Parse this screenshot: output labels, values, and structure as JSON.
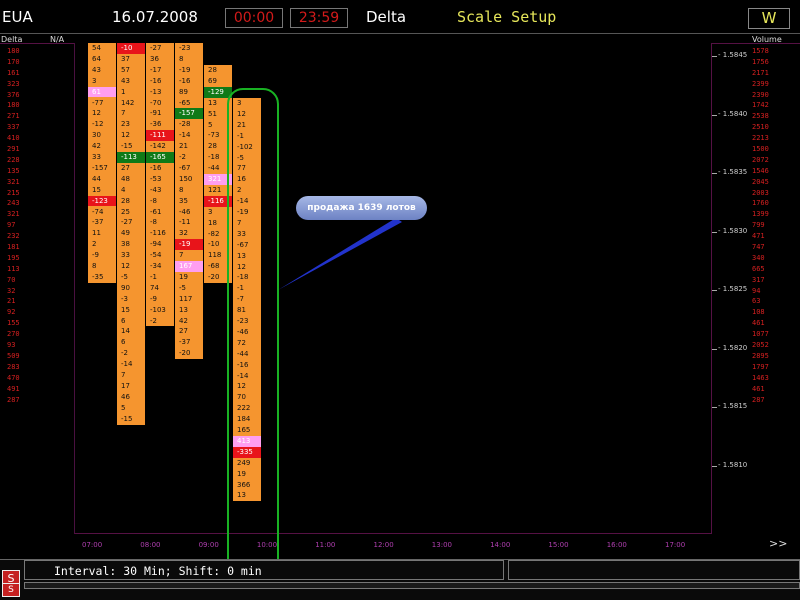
{
  "header": {
    "symbol": "EUA",
    "date": "16.07.2008",
    "time_from": "00:00",
    "time_to": "23:59",
    "mode": "Delta",
    "scale_setup": "Scale Setup",
    "w_button": "W"
  },
  "labels": {
    "left": "Delta",
    "na": "N/A",
    "right": "Volume"
  },
  "left_column": [
    "180",
    "170",
    "161",
    "323",
    "376",
    "180",
    "271",
    "337",
    "410",
    "291",
    "228",
    "135",
    "321",
    "215",
    "243",
    "321",
    "97",
    "232",
    "181",
    "195",
    "113",
    "70",
    "32",
    "21",
    "92",
    "155",
    "270",
    "93",
    "509",
    "283",
    "470",
    "491",
    "287"
  ],
  "right_column": [
    "1578",
    "1756",
    "2171",
    "2399",
    "2390",
    "1742",
    "2538",
    "2510",
    "2213",
    "1500",
    "2072",
    "1546",
    "2045",
    "2003",
    "1760",
    "1399",
    "799",
    "471",
    "747",
    "340",
    "665",
    "317",
    "94",
    "63",
    "108",
    "461",
    "1077",
    "2052",
    "2895",
    "1797",
    "1463",
    "461",
    "287"
  ],
  "price_axis": [
    "1.5845",
    "1.5840",
    "1.5835",
    "1.5830",
    "1.5825",
    "1.5820",
    "1.5815",
    "1.5810"
  ],
  "time_axis": [
    "07:00",
    "08:00",
    "09:00",
    "10:00",
    "11:00",
    "12:00",
    "13:00",
    "14:00",
    "15:00",
    "16:00",
    "17:00"
  ],
  "bars": [
    {
      "id": "bar-1",
      "cells": [
        {
          "v": "54"
        },
        {
          "v": "64"
        },
        {
          "v": "43"
        },
        {
          "v": "3"
        },
        {
          "v": "61",
          "c": "pink"
        },
        {
          "v": "-77"
        },
        {
          "v": "12"
        },
        {
          "v": "-12"
        },
        {
          "v": "30"
        },
        {
          "v": "42"
        },
        {
          "v": "33"
        },
        {
          "v": "-157"
        },
        {
          "v": "44"
        },
        {
          "v": "15"
        },
        {
          "v": "-123",
          "c": "red"
        },
        {
          "v": "-74"
        },
        {
          "v": "-37"
        },
        {
          "v": "11"
        },
        {
          "v": "2"
        },
        {
          "v": "-9"
        },
        {
          "v": "8"
        },
        {
          "v": "-35"
        }
      ]
    },
    {
      "id": "bar-2",
      "cells": [
        {
          "v": "-10",
          "c": "red"
        },
        {
          "v": "37"
        },
        {
          "v": "57"
        },
        {
          "v": "43"
        },
        {
          "v": "1"
        },
        {
          "v": "142"
        },
        {
          "v": "7"
        },
        {
          "v": "23"
        },
        {
          "v": "12"
        },
        {
          "v": "-15"
        },
        {
          "v": "-113",
          "c": "green"
        },
        {
          "v": "27"
        },
        {
          "v": "48"
        },
        {
          "v": "4"
        },
        {
          "v": "28"
        },
        {
          "v": "25"
        },
        {
          "v": "-27"
        },
        {
          "v": "49"
        },
        {
          "v": "38"
        },
        {
          "v": "33"
        },
        {
          "v": "12"
        },
        {
          "v": "-5"
        },
        {
          "v": "90"
        },
        {
          "v": "-3"
        },
        {
          "v": "15"
        },
        {
          "v": "6"
        },
        {
          "v": "14"
        },
        {
          "v": "6"
        },
        {
          "v": "-2"
        },
        {
          "v": "-14"
        },
        {
          "v": "7"
        },
        {
          "v": "17"
        },
        {
          "v": "46"
        },
        {
          "v": "5"
        },
        {
          "v": "-15"
        }
      ]
    },
    {
      "id": "bar-3",
      "cells": [
        {
          "v": "-27"
        },
        {
          "v": "36"
        },
        {
          "v": "-17"
        },
        {
          "v": "-16"
        },
        {
          "v": "-13"
        },
        {
          "v": "-70"
        },
        {
          "v": "-91"
        },
        {
          "v": "-36"
        },
        {
          "v": "-111",
          "c": "red"
        },
        {
          "v": "-142"
        },
        {
          "v": "-165",
          "c": "green"
        },
        {
          "v": "-16"
        },
        {
          "v": "-53"
        },
        {
          "v": "-43"
        },
        {
          "v": "-8"
        },
        {
          "v": "-61"
        },
        {
          "v": "-8"
        },
        {
          "v": "-116"
        },
        {
          "v": "-94"
        },
        {
          "v": "-54"
        },
        {
          "v": "-34"
        },
        {
          "v": "-1"
        },
        {
          "v": "74"
        },
        {
          "v": "-9"
        },
        {
          "v": "-103"
        },
        {
          "v": "-2"
        }
      ]
    },
    {
      "id": "bar-4",
      "cells": [
        {
          "v": "-23"
        },
        {
          "v": "8"
        },
        {
          "v": "-19"
        },
        {
          "v": "-16"
        },
        {
          "v": "89"
        },
        {
          "v": "-65"
        },
        {
          "v": "-157",
          "c": "green"
        },
        {
          "v": "-28"
        },
        {
          "v": "-14"
        },
        {
          "v": "21"
        },
        {
          "v": "-2"
        },
        {
          "v": "-67"
        },
        {
          "v": "150"
        },
        {
          "v": "8"
        },
        {
          "v": "35"
        },
        {
          "v": "-46"
        },
        {
          "v": "-11"
        },
        {
          "v": "32"
        },
        {
          "v": "-19",
          "c": "red"
        },
        {
          "v": "7"
        },
        {
          "v": "167",
          "c": "pink"
        },
        {
          "v": "19"
        },
        {
          "v": "-5"
        },
        {
          "v": "117"
        },
        {
          "v": "13"
        },
        {
          "v": "42"
        },
        {
          "v": "27"
        },
        {
          "v": "-37"
        },
        {
          "v": "-20"
        }
      ]
    },
    {
      "id": "bar-5",
      "cells": [
        {
          "v": "28"
        },
        {
          "v": "69"
        },
        {
          "v": "-129",
          "c": "green"
        },
        {
          "v": "13"
        },
        {
          "v": "51"
        },
        {
          "v": "5"
        },
        {
          "v": "-73"
        },
        {
          "v": "28"
        },
        {
          "v": "-18"
        },
        {
          "v": "-44"
        },
        {
          "v": "321",
          "c": "pink"
        },
        {
          "v": "121"
        },
        {
          "v": "-116",
          "c": "red"
        },
        {
          "v": "3"
        },
        {
          "v": "18"
        },
        {
          "v": "-82"
        },
        {
          "v": "-10"
        },
        {
          "v": "118"
        },
        {
          "v": "-68"
        },
        {
          "v": "-20"
        }
      ]
    },
    {
      "id": "bar-6",
      "cells": [
        {
          "v": "3"
        },
        {
          "v": "12"
        },
        {
          "v": "21"
        },
        {
          "v": "-1"
        },
        {
          "v": "-102"
        },
        {
          "v": "-5"
        },
        {
          "v": "77"
        },
        {
          "v": "16"
        },
        {
          "v": "2"
        },
        {
          "v": "-14"
        },
        {
          "v": "-19"
        },
        {
          "v": "7"
        },
        {
          "v": "33"
        },
        {
          "v": "-67"
        },
        {
          "v": "13"
        },
        {
          "v": "12"
        },
        {
          "v": "-18"
        },
        {
          "v": "-1"
        },
        {
          "v": "-7"
        },
        {
          "v": "81"
        },
        {
          "v": "-23"
        },
        {
          "v": "-46"
        },
        {
          "v": "72"
        },
        {
          "v": "-44"
        },
        {
          "v": "-16"
        },
        {
          "v": "-14"
        },
        {
          "v": "12"
        },
        {
          "v": "70"
        },
        {
          "v": "222"
        },
        {
          "v": "184"
        },
        {
          "v": "165"
        },
        {
          "v": "413",
          "c": "pink"
        },
        {
          "v": "-335",
          "c": "red"
        },
        {
          "v": "249"
        },
        {
          "v": "19"
        },
        {
          "v": "366"
        },
        {
          "v": "13"
        }
      ]
    }
  ],
  "annotation": {
    "text": "продажа 1639 лотов"
  },
  "status": {
    "interval": "Interval: 30 Min; Shift: 0 min",
    "icon": "S"
  }
}
